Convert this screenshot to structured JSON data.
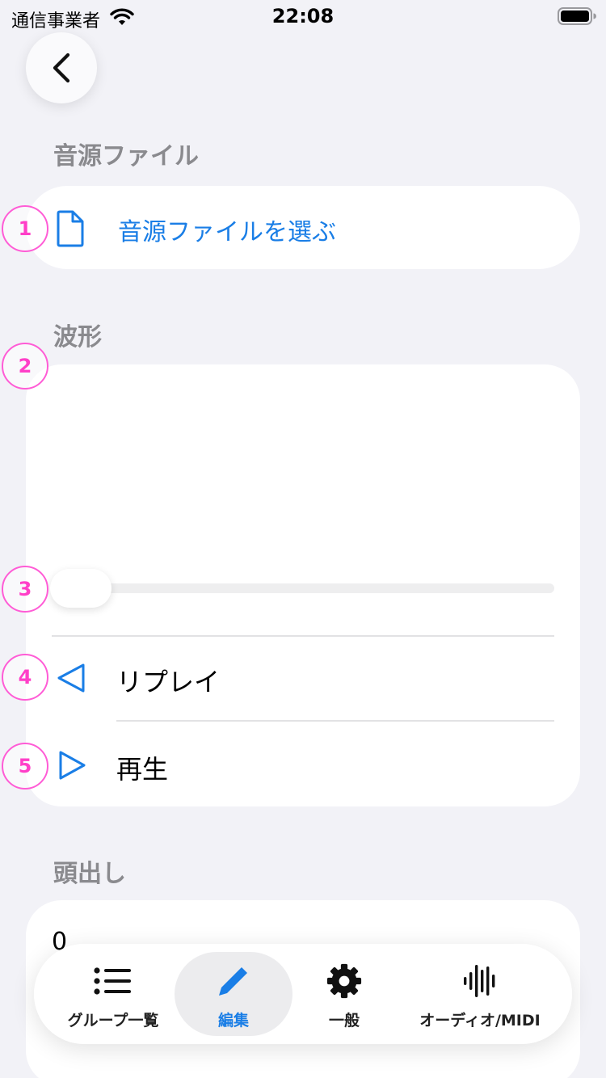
{
  "status_bar": {
    "carrier": "通信事業者",
    "time": "22:08"
  },
  "colors": {
    "accent": "#1a7ee6",
    "badge": "#ff3fc8",
    "background": "#f2f2f7"
  },
  "sections": {
    "source_file": {
      "header": "音源ファイル",
      "choose_label": "音源ファイルを選ぶ",
      "icon": "document-icon"
    },
    "waveform": {
      "header": "波形",
      "playback_position": 0,
      "replay_label": "リプレイ",
      "replay_icon": "replay-triangle-icon",
      "play_label": "再生",
      "play_icon": "play-triangle-icon"
    },
    "cue": {
      "header": "頭出し",
      "value": "0"
    }
  },
  "tab_bar": {
    "selected": "編集",
    "tabs": [
      {
        "label": "グループ一覧",
        "icon": "list-icon"
      },
      {
        "label": "編集",
        "icon": "pencil-icon"
      },
      {
        "label": "一般",
        "icon": "gear-icon"
      },
      {
        "label": "オーディオ/MIDI",
        "icon": "waveform-icon"
      }
    ]
  },
  "annotations": [
    "1",
    "2",
    "3",
    "4",
    "5"
  ]
}
